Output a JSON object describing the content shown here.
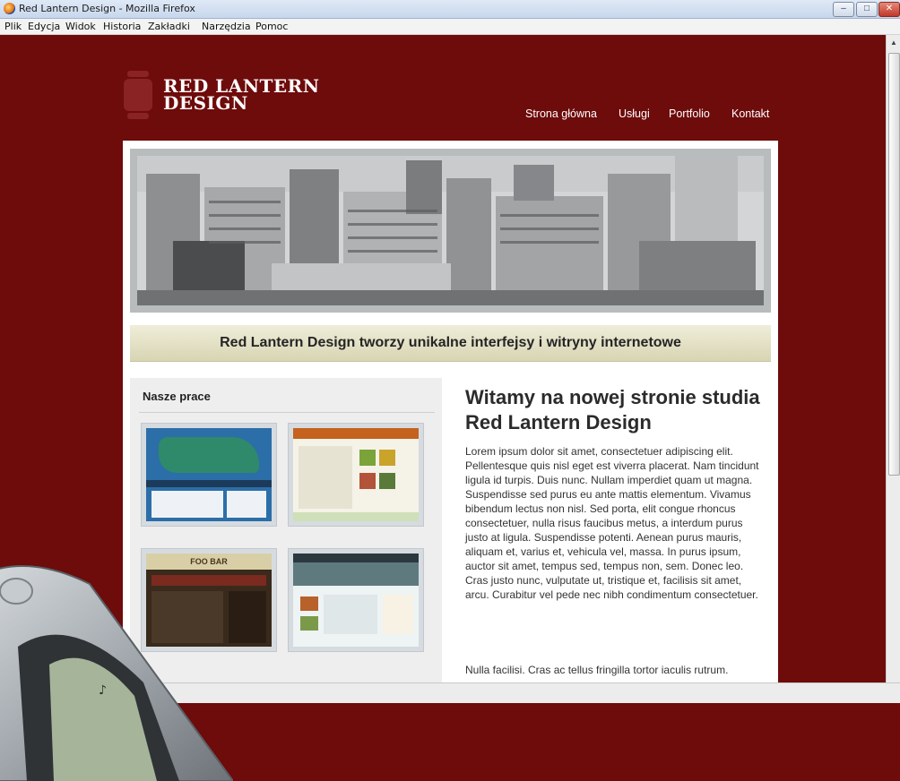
{
  "window": {
    "title": "Red Lantern Design - Mozilla Firefox",
    "minimize": "–",
    "maximize": "□",
    "close": "✕"
  },
  "menu": {
    "items": [
      {
        "label": "Plik"
      },
      {
        "label": "Edycja"
      },
      {
        "label": "Widok"
      },
      {
        "label": "Historia"
      },
      {
        "label": "Zakładki"
      },
      {
        "label": "Narzędzia"
      },
      {
        "label": "Pomoc"
      }
    ]
  },
  "site": {
    "logo_line1": "RED LANTERN",
    "logo_line2": "DESIGN",
    "nav": [
      {
        "label": "Strona główna"
      },
      {
        "label": "Usługi"
      },
      {
        "label": "Portfolio"
      },
      {
        "label": "Kontakt"
      }
    ],
    "tagline": "Red Lantern Design tworzy unikalne interfejsy i witryny internetowe",
    "works_title": "Nasze prace",
    "welcome_title": "Witamy na nowej stronie studia Red Lantern Design",
    "welcome_text": "Lorem ipsum dolor sit amet, consectetuer adipiscing elit. Pellentesque quis nisl eget est viverra placerat. Nam tincidunt ligula id turpis. Duis nunc. Nullam imperdiet quam ut magna. Suspendisse sed purus eu ante mattis elementum. Vivamus bibendum lectus non nisl. Sed porta, elit congue rhoncus consectetuer, nulla risus faucibus metus, a interdum purus justo at ligula. Suspendisse potenti. Aenean purus mauris, aliquam et, varius et, vehicula vel, massa. In purus ipsum, auctor sit amet, tempus sed, tempus non, sem. Donec leo. Cras justo nunc, vulputate ut, tristique et, facilisis sit amet, arcu. Curabitur vel pede nec nibh condimentum consectetuer.",
    "welcome_text2": "Nulla facilisi. Cras ac tellus fringilla tortor iaculis rutrum.",
    "thumb3_text": "FOO BAR"
  },
  "colors": {
    "page_bg": "#6e0b0b",
    "logo_accent": "#8a2323",
    "tagline_bg": "#dcd9ba"
  }
}
